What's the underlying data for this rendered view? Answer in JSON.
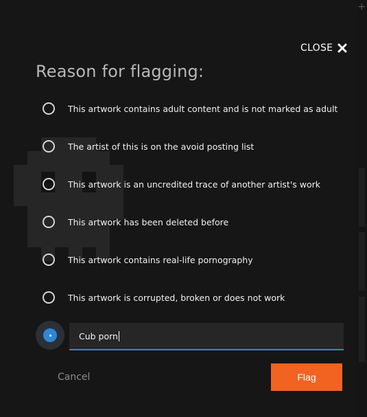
{
  "dialog": {
    "close_label": "CLOSE",
    "title": "Reason for flagging:",
    "options": [
      {
        "label": "This artwork contains adult content and is not marked as adult"
      },
      {
        "label": "The artist of this is on the avoid posting list"
      },
      {
        "label": "This artwork is an uncredited trace of another artist's work"
      },
      {
        "label": "This artwork has been deleted before"
      },
      {
        "label": "This artwork contains real-life pornography"
      },
      {
        "label": "This artwork is corrupted, broken or does not work"
      }
    ],
    "custom_reason": {
      "value": "Cub porn",
      "selected": true
    },
    "cancel_label": "Cancel",
    "flag_label": "Flag"
  },
  "colors": {
    "accent_orange": "#f26322",
    "selected_blue": "#2f86d6",
    "overlay": "#161616"
  },
  "icons": {
    "close": "close-icon",
    "background_figure": "pixel-ghost-icon",
    "corner": "plus-icon"
  }
}
